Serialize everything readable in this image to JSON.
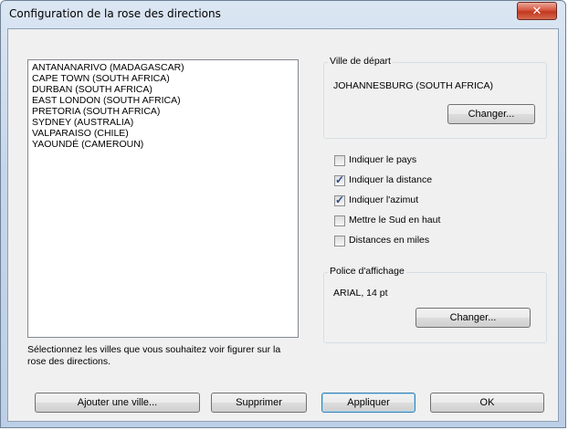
{
  "window": {
    "title": "Configuration de la rose des directions",
    "close_icon": "close-icon"
  },
  "cities": [
    "ANTANANARIVO (MADAGASCAR)",
    "CAPE TOWN (SOUTH AFRICA)",
    "DURBAN (SOUTH AFRICA)",
    "EAST LONDON (SOUTH AFRICA)",
    "PRETORIA (SOUTH AFRICA)",
    "SYDNEY (AUSTRALIA)",
    "VALPARAISO (CHILE)",
    "YAOUNDÉ (CAMEROUN)"
  ],
  "hint": "Sélectionnez les villes que vous souhaitez voir figurer sur la rose des directions.",
  "departure": {
    "label": "Ville de départ",
    "value": "JOHANNESBURG (SOUTH AFRICA)",
    "change_label": "Changer..."
  },
  "options": [
    {
      "label": "Indiquer le pays",
      "checked": false
    },
    {
      "label": "Indiquer la distance",
      "checked": true
    },
    {
      "label": "Indiquer l'azimut",
      "checked": true
    },
    {
      "label": "Mettre le Sud en haut",
      "checked": false
    },
    {
      "label": "Distances en miles",
      "checked": false
    }
  ],
  "font": {
    "label": "Police d'affichage",
    "value": "ARIAL, 14 pt",
    "change_label": "Changer..."
  },
  "buttons": {
    "add_city": "Ajouter une ville...",
    "delete": "Supprimer",
    "apply": "Appliquer",
    "ok": "OK"
  }
}
